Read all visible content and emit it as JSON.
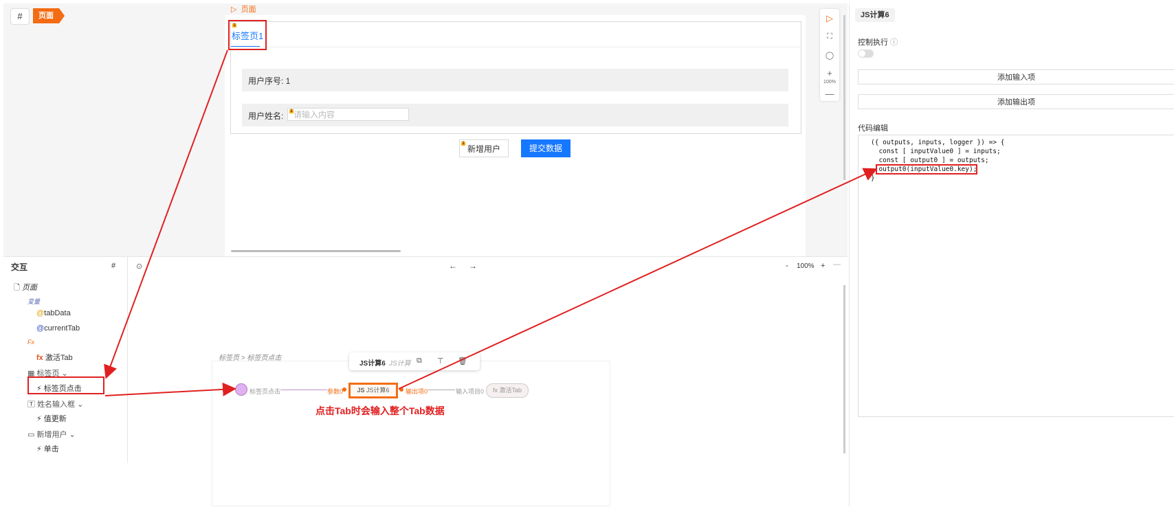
{
  "toolbar": {
    "hash": "#",
    "page_tag": "页面",
    "crumb": "页面"
  },
  "canvas": {
    "tab_label": "标签页1",
    "user_id_label": "用户序号: 1",
    "user_name_label": "用户姓名:",
    "user_name_placeholder": "请输入内容",
    "add_user": "新增用户",
    "submit": "提交数据",
    "zoom": "100%"
  },
  "right_panel": {
    "title": "JS计算6",
    "control_exec": "控制执行",
    "add_input": "添加输入项",
    "add_output": "添加输出项",
    "code_edit": "代码编辑",
    "code_lines": [
      "({ outputs, inputs, logger }) => {",
      "  const [ inputValue0 ] = inputs;",
      "  const [ output0 ] = outputs;",
      "  output0(inputValue0.key);",
      "}"
    ]
  },
  "interact": {
    "title": "交互",
    "hash": "#",
    "page": "页面",
    "vars_label": "变量",
    "var1": "tabData",
    "var2": "currentTab",
    "fx_label": "Fx",
    "fx1": "激活Tab",
    "tabs_group": "标签页",
    "tab_click": "标签页点击",
    "name_input": "姓名输入框",
    "value_update": "值更新",
    "add_user_group": "新增用户",
    "click": "单击"
  },
  "flow": {
    "nav_back": "←",
    "nav_forward": "→",
    "zoom_minus": "-",
    "zoom": "100%",
    "zoom_plus": "+",
    "breadcrumb": "标签页 > 标签页点击",
    "popup_title": "JS计算6",
    "popup_sub": "JS计算",
    "node_event": "标签页点击",
    "param": "参数0",
    "js_node": "JS计算6",
    "output_pin": "输出项0",
    "input_pin": "输入项目0",
    "fx_node": "激活Tab",
    "annotation": "点击Tab时会输入整个Tab数据"
  }
}
